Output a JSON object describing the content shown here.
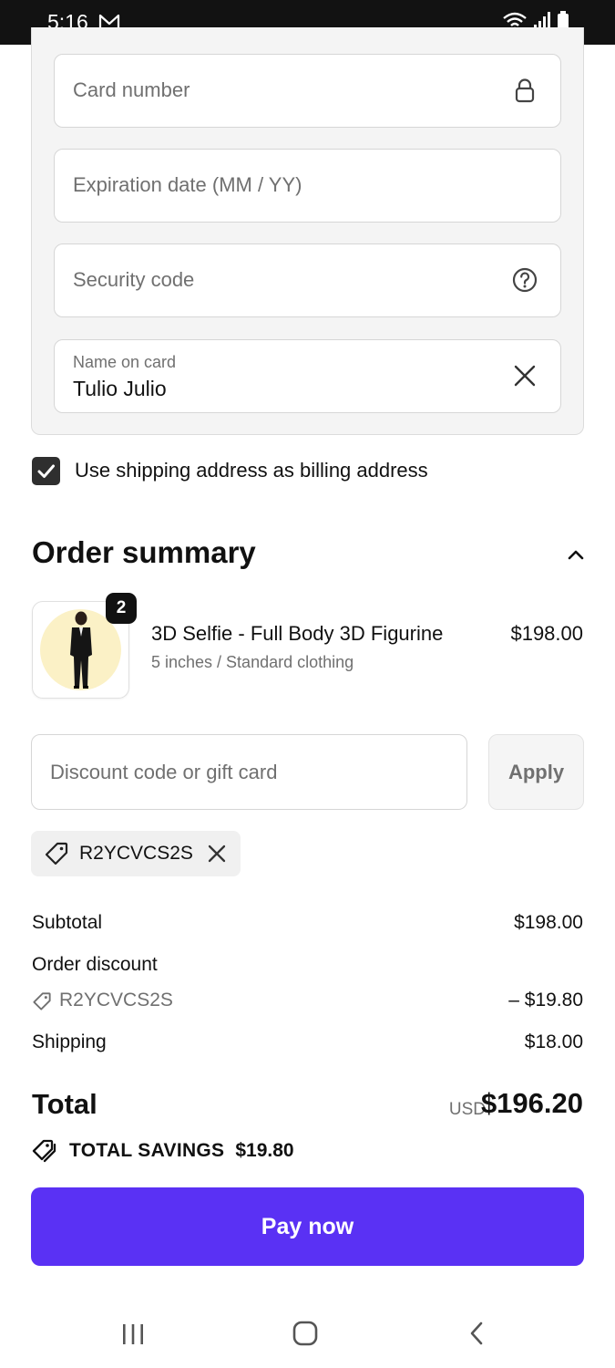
{
  "status_bar": {
    "time": "5:16"
  },
  "card_form": {
    "card_number_placeholder": "Card number",
    "expiration_placeholder": "Expiration date (MM / YY)",
    "security_code_placeholder": "Security code",
    "name_label": "Name on card",
    "name_value": "Tulio Julio"
  },
  "billing": {
    "checkbox_label": "Use shipping address as billing address",
    "checked": true
  },
  "order_summary": {
    "title": "Order summary",
    "product": {
      "quantity": "2",
      "name": "3D Selfie - Full Body 3D Figurine",
      "variant": "5 inches / Standard clothing",
      "price": "$198.00"
    },
    "discount": {
      "placeholder": "Discount code or gift card",
      "apply_label": "Apply",
      "applied_code": "R2YCVCS2S"
    },
    "lines": {
      "subtotal_label": "Subtotal",
      "subtotal_value": "$198.00",
      "order_discount_label": "Order discount",
      "discount_code": "R2YCVCS2S",
      "discount_value": "– $19.80",
      "shipping_label": "Shipping",
      "shipping_value": "$18.00"
    },
    "total": {
      "label": "Total",
      "currency": "USD",
      "value": "$196.20",
      "savings_label": "TOTAL SAVINGS",
      "savings_value": "$19.80"
    },
    "pay_label": "Pay now"
  },
  "colors": {
    "accent": "#5a31f4",
    "status_bar": "#121212"
  }
}
